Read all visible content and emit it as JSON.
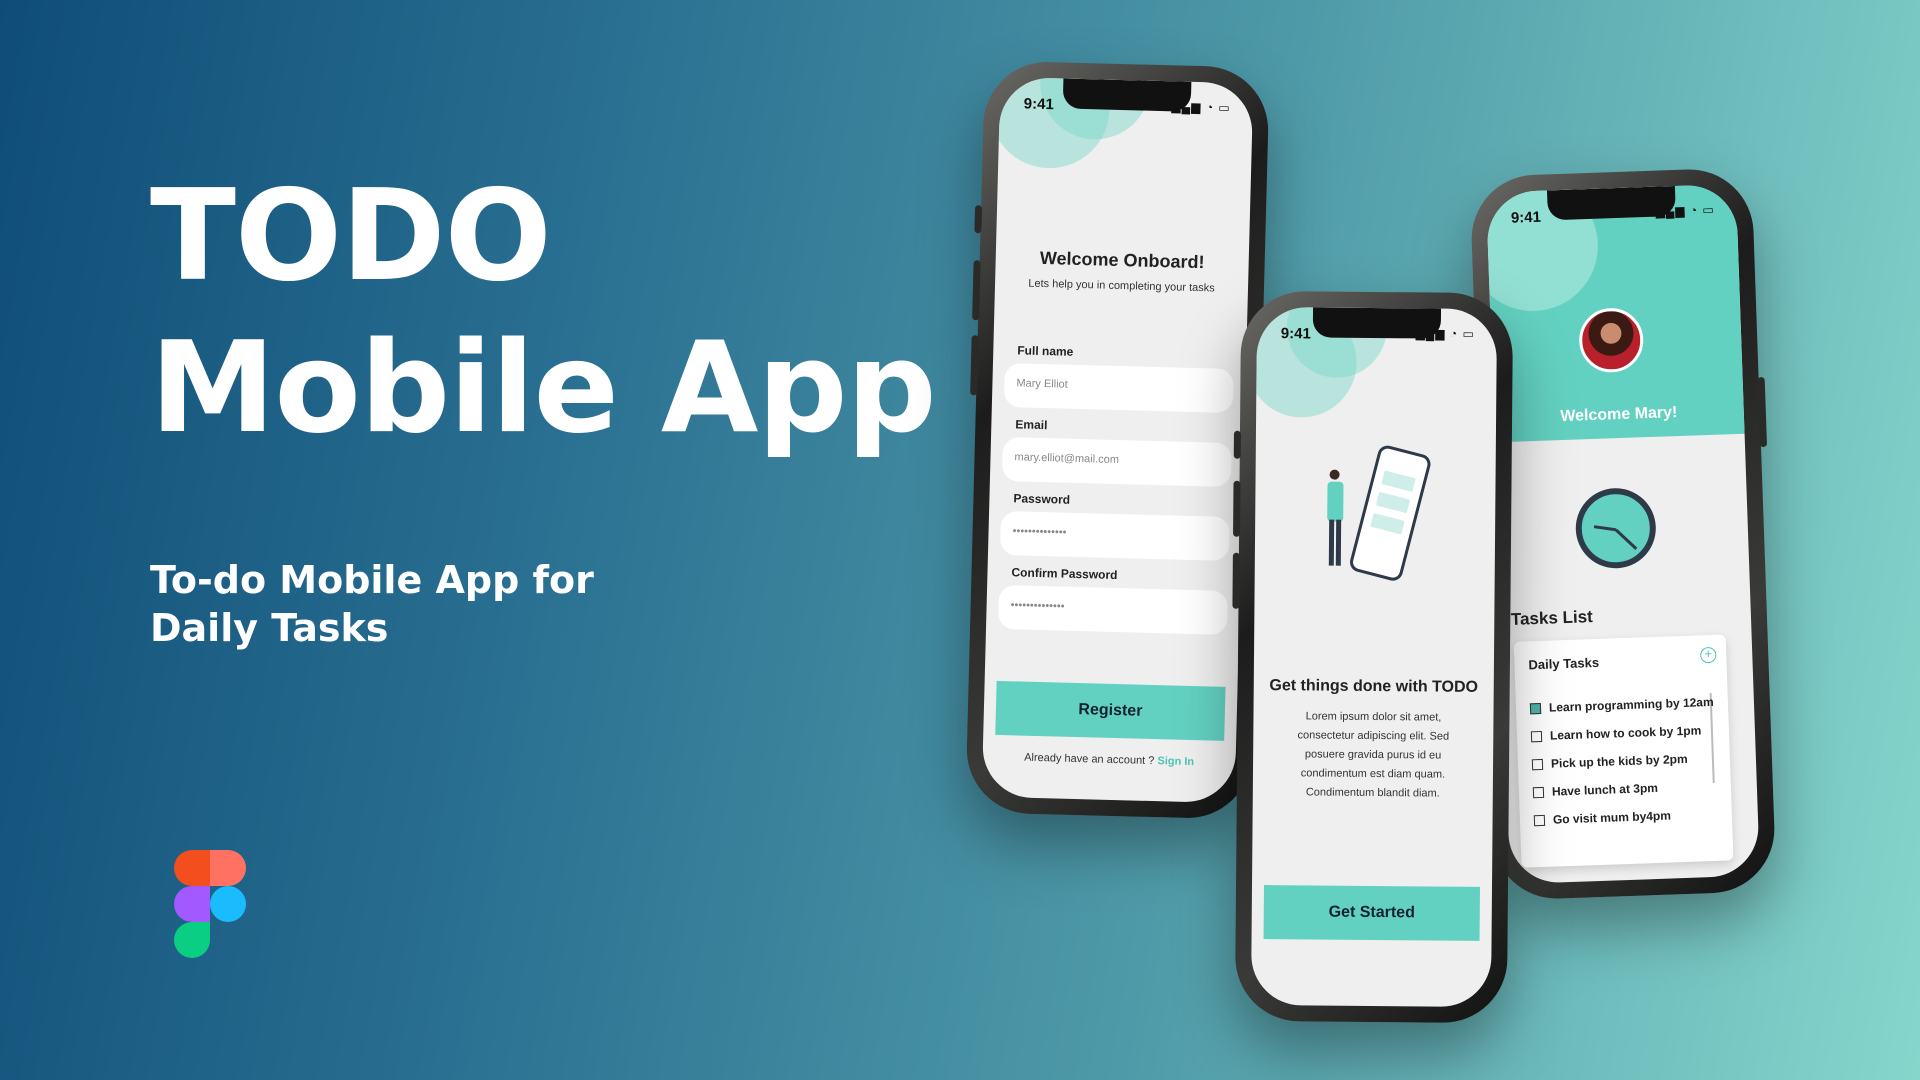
{
  "hero": {
    "title_line1": "TODO",
    "title_line2": "Mobile App",
    "subtitle_line1": "To-do Mobile App for",
    "subtitle_line2": "Daily Tasks"
  },
  "colors": {
    "accent": "#63d1c1",
    "figma": [
      "#f24e1e",
      "#ff7262",
      "#a259ff",
      "#1abcfe",
      "#0acf83"
    ]
  },
  "phone_register": {
    "time": "9:41",
    "title": "Welcome Onboard!",
    "subtitle": "Lets help you in completing your tasks",
    "fields": [
      {
        "label": "Full name",
        "value": "Mary Elliot"
      },
      {
        "label": "Email",
        "value": "mary.elliot@mail.com"
      },
      {
        "label": "Password",
        "value": "••••••••••••••"
      },
      {
        "label": "Confirm Password",
        "value": "••••••••••••••"
      }
    ],
    "button": "Register",
    "footer_text": "Already have an account ?",
    "footer_link": "Sign In"
  },
  "phone_start": {
    "time": "9:41",
    "title": "Get things done with TODO",
    "body": "Lorem ipsum dolor sit amet, consectetur adipiscing elit. Sed posuere gravida purus id eu condimentum est diam quam. Condimentum blandit diam.",
    "button": "Get Started"
  },
  "phone_tasks": {
    "time": "9:41",
    "greeting": "Welcome Mary!",
    "section_title": "Tasks List",
    "card_title": "Daily Tasks",
    "tasks": [
      {
        "text": "Learn programming by 12am",
        "done": true
      },
      {
        "text": "Learn how to cook by 1pm",
        "done": false
      },
      {
        "text": "Pick up the kids by 2pm",
        "done": false
      },
      {
        "text": "Have lunch at 3pm",
        "done": false
      },
      {
        "text": "Go visit mum by4pm",
        "done": false
      }
    ]
  }
}
